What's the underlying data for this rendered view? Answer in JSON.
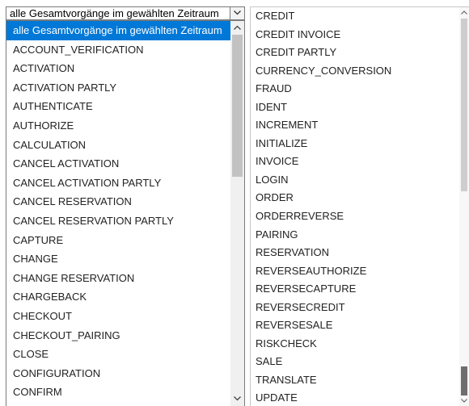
{
  "select": {
    "value": "alle Gesamtvorgänge im gewählten Zeitraum"
  },
  "dropdown": {
    "items": [
      "alle Gesamtvorgänge im gewählten Zeitraum",
      "ACCOUNT_VERIFICATION",
      "ACTIVATION",
      "ACTIVATION PARTLY",
      "AUTHENTICATE",
      "AUTHORIZE",
      "CALCULATION",
      "CANCEL ACTIVATION",
      "CANCEL ACTIVATION PARTLY",
      "CANCEL RESERVATION",
      "CANCEL RESERVATION PARTLY",
      "CAPTURE",
      "CHANGE",
      "CHANGE RESERVATION",
      "CHARGEBACK",
      "CHECKOUT",
      "CHECKOUT_PAIRING",
      "CLOSE",
      "CONFIGURATION",
      "CONFIRM"
    ],
    "selected_index": 0
  },
  "listbox": {
    "items": [
      "CREDIT",
      "CREDIT INVOICE",
      "CREDIT PARTLY",
      "CURRENCY_CONVERSION",
      "FRAUD",
      "IDENT",
      "INCREMENT",
      "INITIALIZE",
      "INVOICE",
      "LOGIN",
      "ORDER",
      "ORDERREVERSE",
      "PAIRING",
      "RESERVATION",
      "REVERSEAUTHORIZE",
      "REVERSECAPTURE",
      "REVERSECREDIT",
      "REVERSESALE",
      "RISKCHECK",
      "SALE",
      "TRANSLATE",
      "UPDATE"
    ]
  },
  "colors": {
    "selection": "#0078d7",
    "scrollbar_track": "#f0f0f0",
    "scrollbar_thumb": "#c2c2c2"
  }
}
